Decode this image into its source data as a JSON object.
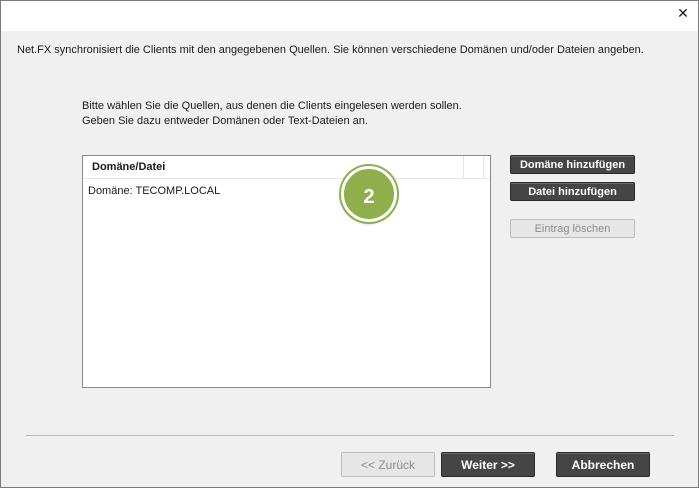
{
  "window": {
    "close_glyph": "✕"
  },
  "intro_text": "Net.FX synchronisiert die Clients mit den angegebenen Quellen. Sie können verschiedene Domänen und/oder Dateien angeben.",
  "description": "Bitte wählen Sie die Quellen, aus denen die Clients eingelesen werden sollen. Geben Sie dazu entweder Domänen oder Text-Dateien an.",
  "list": {
    "column_header": "Domäne/Datei",
    "rows": [
      "Domäne: TECOMP.LOCAL"
    ]
  },
  "badge": "2",
  "side_buttons": {
    "add_domain": "Domäne hinzufügen",
    "add_file": "Datei hinzufügen",
    "delete_entry": "Eintrag löschen"
  },
  "footer": {
    "back": "<< Zurück",
    "next": "Weiter >>",
    "cancel": "Abbrechen"
  },
  "colors": {
    "badge": "#8fae4c",
    "button_dark": "#454545",
    "button_disabled": "#e6e6e6",
    "window_bg": "#f0f0f0"
  },
  "icons": {
    "close": "close-icon"
  }
}
